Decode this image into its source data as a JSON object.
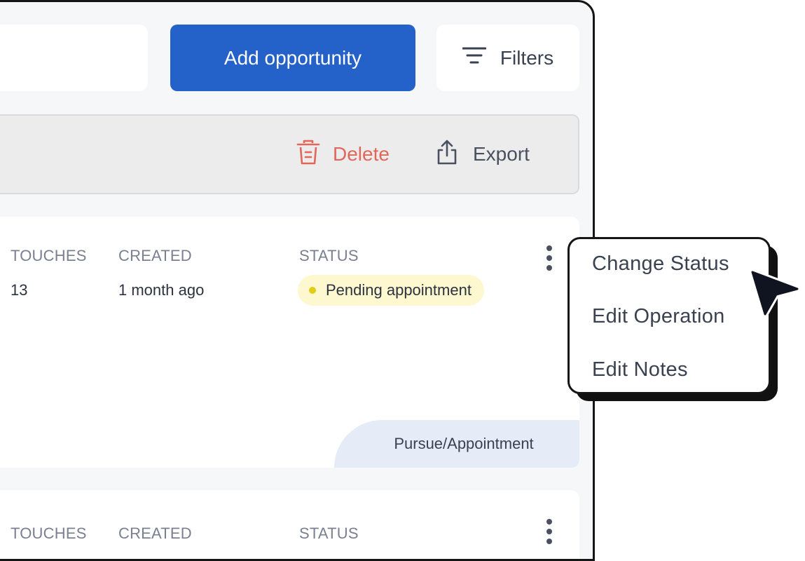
{
  "header": {
    "add_button": "Add opportunity",
    "filters_button": "Filters"
  },
  "toolbar": {
    "delete_label": "Delete",
    "export_label": "Export"
  },
  "columns": {
    "touches": "TOUCHES",
    "created": "CREATED",
    "status": "STATUS"
  },
  "rows": [
    {
      "touches": "13",
      "created": "1 month ago",
      "status": "Pending appointment",
      "stage": "Pursue/Appointment"
    }
  ],
  "context_menu": {
    "items": [
      "Change Status",
      "Edit Operation",
      "Edit Notes"
    ]
  },
  "colors": {
    "primary": "#2461c9",
    "delete": "#e2675b",
    "status_pending_bg": "#fdf8cf",
    "status_pending_dot": "#e2cc14",
    "stage_bg": "#e5ecf7"
  },
  "icons": {
    "filters": "filter-lines-icon",
    "delete": "trash-icon",
    "export": "upload-share-icon",
    "row_menu": "kebab-menu-icon",
    "pointer": "mouse-cursor-icon"
  }
}
